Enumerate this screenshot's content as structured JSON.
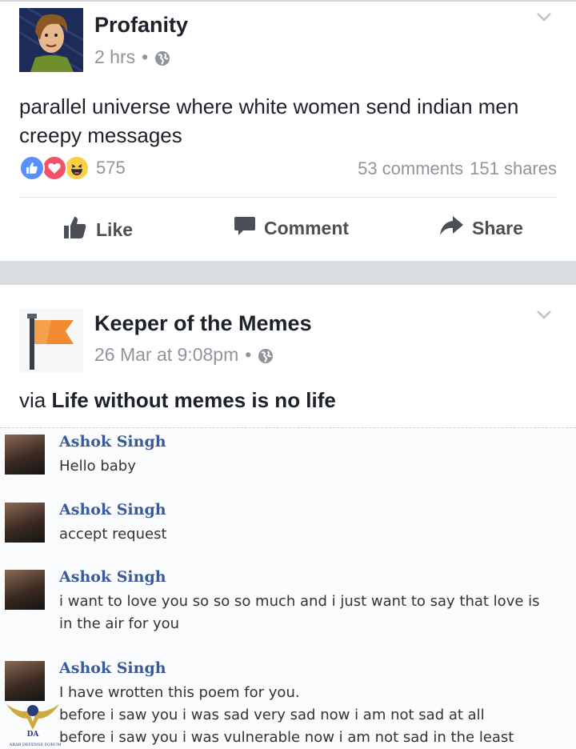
{
  "post1": {
    "author": "Profanity",
    "time": "2 hrs",
    "meta_sep": "•",
    "text": "parallel universe where white women send indian men creepy messages",
    "reactions_count": "575",
    "comments": "53 comments",
    "shares": "151 shares",
    "actions": {
      "like": "Like",
      "comment": "Comment",
      "share": "Share"
    }
  },
  "post2": {
    "author": "Keeper of the Memes",
    "time": "26 Mar at 9:08pm",
    "meta_sep": "•",
    "via_prefix": "via",
    "via_source": "Life without memes is no life",
    "messages": [
      {
        "name": "Ashok Singh",
        "text": "Hello baby"
      },
      {
        "name": "Ashok Singh",
        "text": "accept request"
      },
      {
        "name": "Ashok Singh",
        "text": "i want to love you so so so much and i just want to say that love is in the air for you"
      },
      {
        "name": "Ashok Singh",
        "line1": "I have wrotten this poem for you.",
        "line2": "before i saw you i was sad very sad now i am not sad at all",
        "line3": "before i saw you i was vulnerable now i am not sad in the least"
      }
    ]
  },
  "watermark": {
    "initials": "DA",
    "name": "ARAB DEFENSE FORUM"
  },
  "colors": {
    "link_blue": "#3b5998",
    "secondary_text": "#90949c",
    "divider": "#dadde1"
  }
}
